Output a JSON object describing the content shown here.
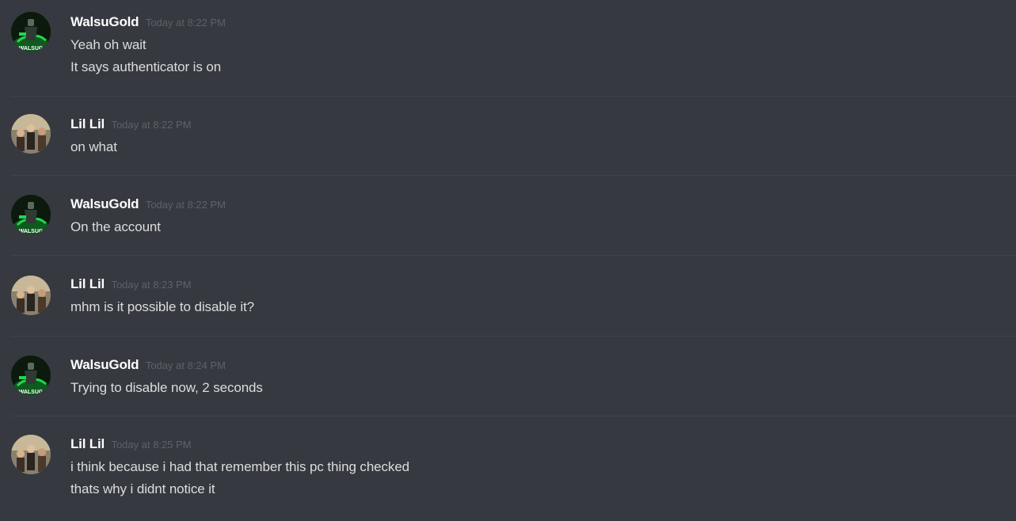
{
  "messages": [
    {
      "author": "WalsuGold",
      "timestamp": "Today at 8:22 PM",
      "avatar": "walsugold-avatar",
      "avatar_text": "WALSUG",
      "lines": [
        "Yeah oh wait",
        "It says authenticator is on"
      ]
    },
    {
      "author": "Lil Lil",
      "timestamp": "Today at 8:22 PM",
      "avatar": "lil-lil-avatar",
      "lines": [
        "on what"
      ]
    },
    {
      "author": "WalsuGold",
      "timestamp": "Today at 8:22 PM",
      "avatar": "walsugold-avatar",
      "avatar_text": "WALSUG",
      "lines": [
        "On the account"
      ]
    },
    {
      "author": "Lil Lil",
      "timestamp": "Today at 8:23 PM",
      "avatar": "lil-lil-avatar",
      "lines": [
        "mhm is it possible to disable it?"
      ]
    },
    {
      "author": "WalsuGold",
      "timestamp": "Today at 8:24 PM",
      "avatar": "walsugold-avatar",
      "avatar_text": "WALSUG",
      "lines": [
        "Trying to disable now, 2 seconds"
      ]
    },
    {
      "author": "Lil Lil",
      "timestamp": "Today at 8:25 PM",
      "avatar": "lil-lil-avatar",
      "lines": [
        "i think because i had that remember this pc thing checked",
        "thats why i didnt notice it"
      ]
    }
  ],
  "colors": {
    "background": "#36393f",
    "username": "#ffffff",
    "timestamp": "#5e6167",
    "text": "#dcddde",
    "divider": "#40434a",
    "walsugold_accent": "#1ed94a"
  }
}
